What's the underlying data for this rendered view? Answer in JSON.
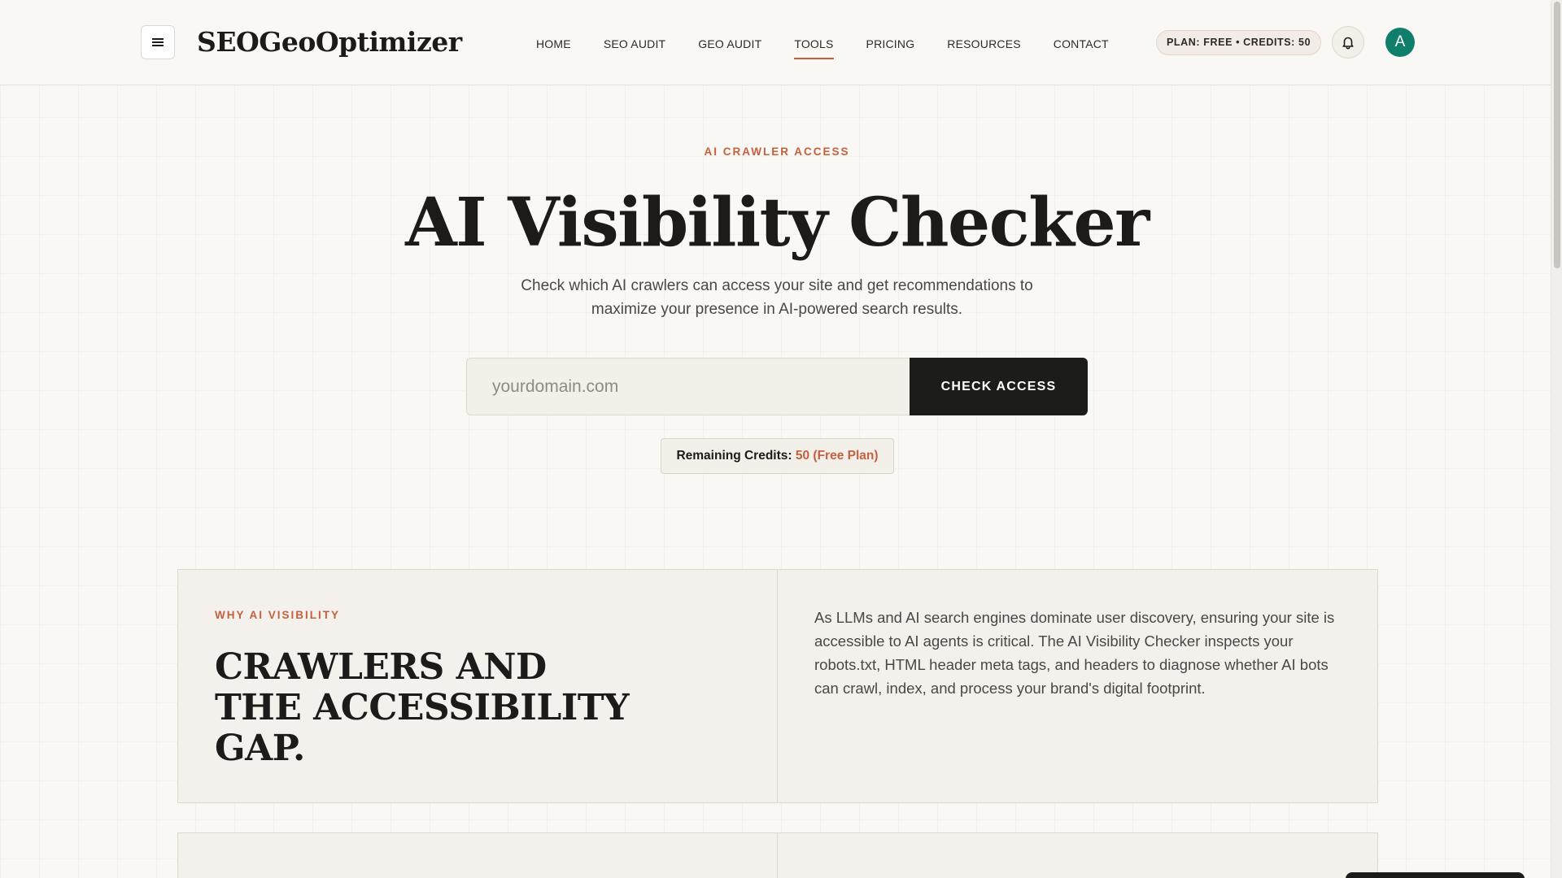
{
  "header": {
    "logo": "SEOGeoOptimizer",
    "menu_icon": "hamburger-icon",
    "nav": [
      {
        "label": "HOME",
        "active": false
      },
      {
        "label": "SEO AUDIT",
        "active": false
      },
      {
        "label": "GEO AUDIT",
        "active": false
      },
      {
        "label": "TOOLS",
        "active": true
      },
      {
        "label": "PRICING",
        "active": false
      },
      {
        "label": "RESOURCES",
        "active": false
      },
      {
        "label": "CONTACT",
        "active": false
      }
    ],
    "plan_pill": "PLAN: FREE • CREDITS: 50",
    "bell_icon": "bell-icon",
    "avatar_initial": "A"
  },
  "hero": {
    "eyebrow": "AI CRAWLER ACCESS",
    "title": "AI Visibility Checker",
    "subtitle": "Check which AI crawlers can access your site and get recommendations to maximize your presence in AI-powered search results.",
    "input_placeholder": "yourdomain.com",
    "input_value": "",
    "check_button": "CHECK ACCESS",
    "credits_label": "Remaining Credits: ",
    "credits_value": "50 (Free Plan)"
  },
  "why": {
    "eyebrow": "WHY AI VISIBILITY",
    "title": "CRAWLERS AND THE ACCESSIBILITY GAP.",
    "body": "As LLMs and AI search engines dominate user discovery, ensuring your site is accessible to AI agents is critical. The AI Visibility Checker inspects your robots.txt, HTML header meta tags, and headers to diagnose whether AI bots can crawl, index, and process your brand's digital footprint."
  },
  "colors": {
    "accent": "#c4603f",
    "dark": "#1c1c1a",
    "avatar": "#0f7e6a",
    "background": "#faf8f4"
  }
}
